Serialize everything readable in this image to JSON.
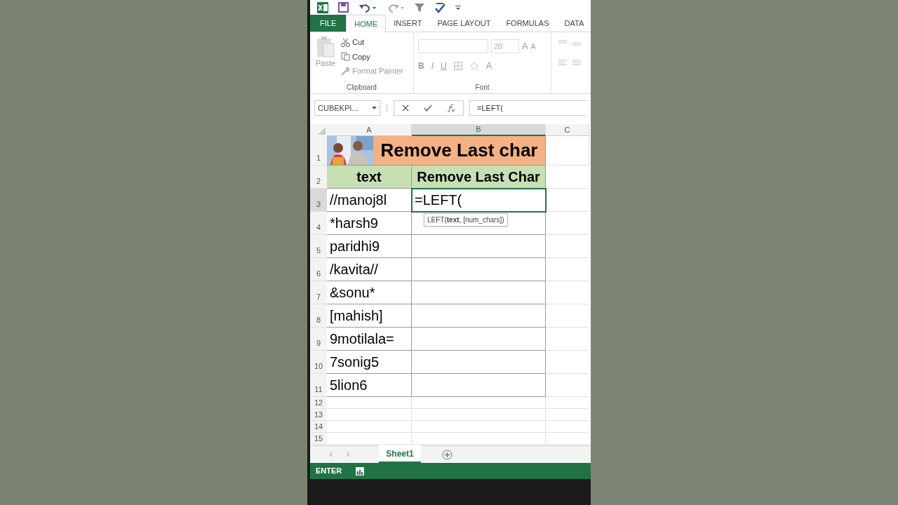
{
  "tabs": [
    {
      "label": "FILE",
      "kind": "file",
      "selected": false
    },
    {
      "label": "HOME",
      "kind": "tab",
      "selected": true
    },
    {
      "label": "INSERT",
      "kind": "tab",
      "selected": false
    },
    {
      "label": "PAGE LAYOUT",
      "kind": "tab",
      "selected": false
    },
    {
      "label": "FORMULAS",
      "kind": "tab",
      "selected": false
    },
    {
      "label": "DATA",
      "kind": "tab",
      "selected": false
    }
  ],
  "clipboard": {
    "paste": "Paste",
    "cut": "Cut",
    "copy": "Copy",
    "format_painter": "Format Painter",
    "group_label": "Clipboard"
  },
  "font": {
    "size": "20",
    "bold": "B",
    "italic": "I",
    "underline": "U",
    "grow": "A",
    "shrink": "A",
    "font_color": "A",
    "group_label": "Font"
  },
  "name_box": "CUBEKPI...",
  "formula": "=LEFT(",
  "columns": [
    {
      "label": "A",
      "selected": false
    },
    {
      "label": "B",
      "selected": true
    },
    {
      "label": "C",
      "selected": false
    }
  ],
  "rows": [
    {
      "number": "1",
      "kind": "title",
      "selected": false,
      "title": "Remove Last char"
    },
    {
      "number": "2",
      "kind": "header",
      "selected": false,
      "a": "text",
      "b": "Remove Last Char"
    },
    {
      "number": "3",
      "kind": "data",
      "selected": true,
      "a": "//manoj8l",
      "b": "=LEFT("
    },
    {
      "number": "4",
      "kind": "data",
      "selected": false,
      "a": "*harsh9"
    },
    {
      "number": "5",
      "kind": "data",
      "selected": false,
      "a": "paridhi9"
    },
    {
      "number": "6",
      "kind": "data",
      "selected": false,
      "a": "/kavita//"
    },
    {
      "number": "7",
      "kind": "data",
      "selected": false,
      "a": "&sonu*"
    },
    {
      "number": "8",
      "kind": "data",
      "selected": false,
      "a": "[mahish]"
    },
    {
      "number": "9",
      "kind": "data",
      "selected": false,
      "a": "9motilala="
    },
    {
      "number": "10",
      "kind": "data",
      "selected": false,
      "a": "7sonig5"
    },
    {
      "number": "11",
      "kind": "data",
      "selected": false,
      "a": "5lion6"
    },
    {
      "number": "12",
      "kind": "empty",
      "selected": false
    },
    {
      "number": "13",
      "kind": "empty",
      "selected": false
    },
    {
      "number": "14",
      "kind": "empty",
      "selected": false
    },
    {
      "number": "15",
      "kind": "empty",
      "selected": false
    }
  ],
  "tooltip": "LEFT(**text**, [num_chars])",
  "sheets": [
    {
      "label": "Sheet1",
      "selected": true
    }
  ],
  "status": "ENTER"
}
